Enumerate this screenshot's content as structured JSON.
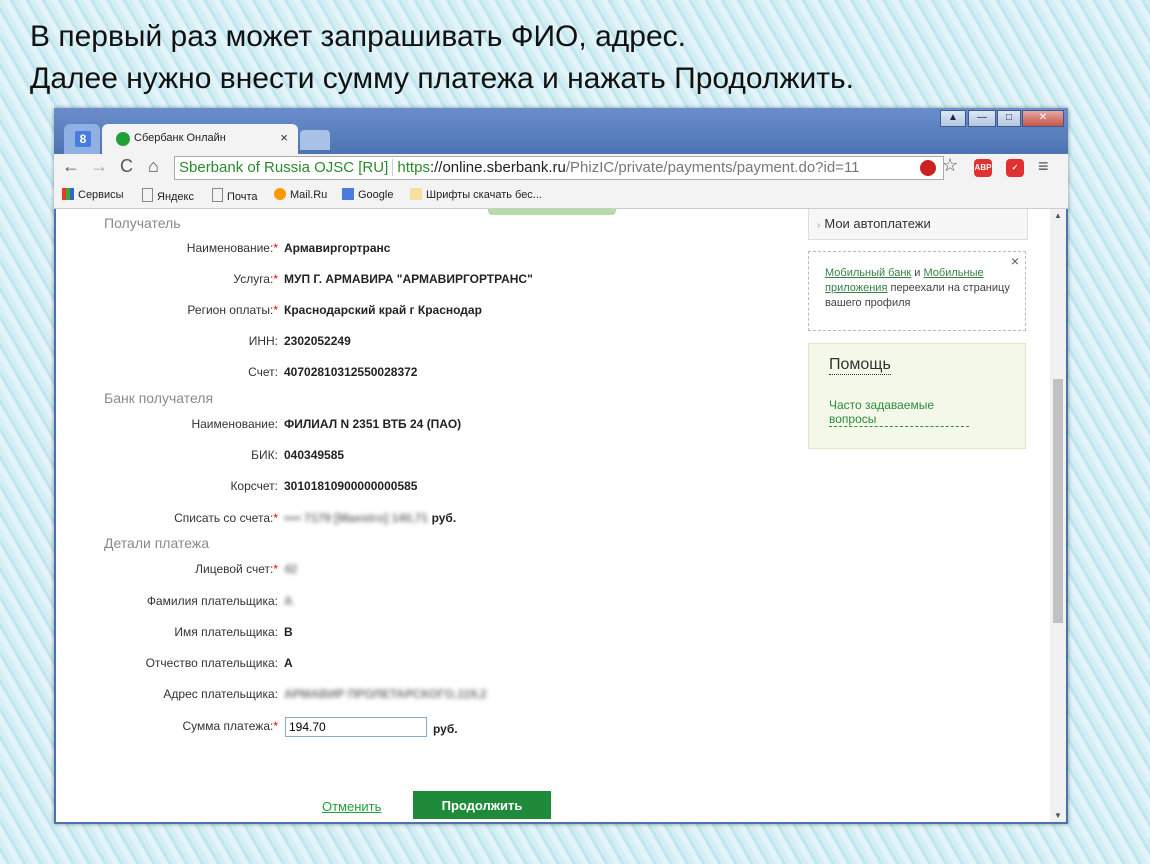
{
  "caption": {
    "line1": "В первый раз может запрашивать ФИО, адрес.",
    "line2": "Далее нужно внести сумму платежа и нажать Продолжить."
  },
  "browser": {
    "tab_title": "Сбербанк Онлайн",
    "tab_close": "×",
    "ev_label": "Sberbank of Russia OJSC [RU]",
    "url_scheme": "https",
    "url_host": "://online.sberbank.ru",
    "url_path": "/PhizIC/private/payments/payment.do?id=11",
    "window_controls": [
      "▲",
      "—",
      "□",
      "✕"
    ],
    "bookmarks": [
      "Сервисы",
      "Яндекс",
      "Почта",
      "Mail.Ru",
      "Google",
      "Шрифты скачать бес..."
    ],
    "extensions": {
      "abp": "ABP"
    }
  },
  "form": {
    "recipient_section": "Получатель",
    "name_label": "Наименование:",
    "name_value": "Армавиргортранс",
    "service_label": "Услуга:",
    "service_value": "МУП Г. АРМАВИРА \"АРМАВИРГОРТРАНС\"",
    "region_label": "Регион оплаты:",
    "region_value": "Краснодарский край г Краснодар",
    "inn_label": "ИНН:",
    "inn_value": "2302052249",
    "account_label": "Счет:",
    "account_value": "40702810312550028372",
    "bank_section": "Банк получателя",
    "bank_name_label": "Наименование:",
    "bank_name_value": "ФИЛИАЛ N 2351 ВТБ 24 (ПАО)",
    "bik_label": "БИК:",
    "bik_value": "040349585",
    "corr_label": "Корсчет:",
    "corr_value": "30101810900000000585",
    "debit_label": "Списать со счета:",
    "debit_value": "•••• 7179 [Maestro] 140,71",
    "debit_currency": "руб.",
    "details_section": "Детали платежа",
    "personal_label": "Лицевой счет:",
    "personal_value": "42",
    "surname_label": "Фамилия плательщика:",
    "surname_value": "А",
    "firstname_label": "Имя плательщика:",
    "firstname_value": "В",
    "patronymic_label": "Отчество плательщика:",
    "patronymic_value": "А",
    "address_label": "Адрес плательщика:",
    "address_value": "АРМАВИР ПРОЛЕТАРСКОГО,119,2",
    "amount_label": "Сумма платежа:",
    "amount_value": "194.70",
    "amount_currency": "руб.",
    "required_mark": "*",
    "cancel_label": "Отменить",
    "continue_label": "Продолжить"
  },
  "sidebar": {
    "autopay": "Мои автоплатежи",
    "mobile_link1": "Мобильный банк",
    "mobile_and": "и",
    "mobile_link2": "Мобильные приложения",
    "mobile_text": "переехали на страницу вашего профиля",
    "mobile_close": "×",
    "help_title": "Помощь",
    "help_link": "Часто задаваемые вопросы"
  }
}
